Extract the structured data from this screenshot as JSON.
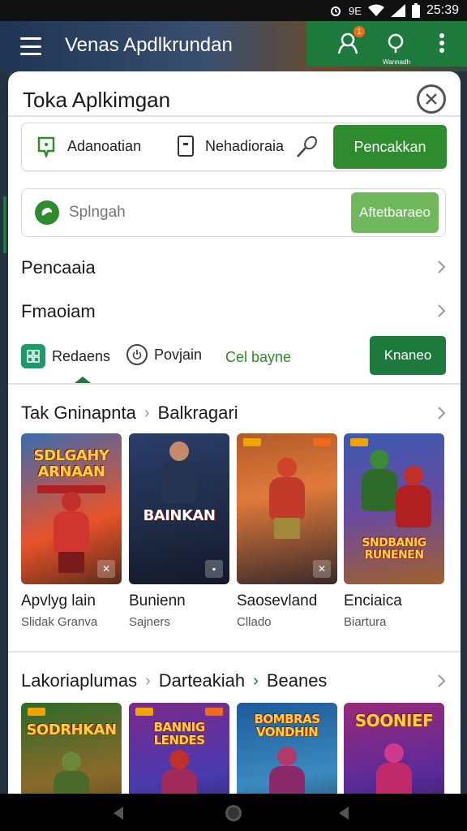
{
  "status_bar": {
    "time": "25:39",
    "network_label": "9E"
  },
  "app_bar": {
    "title": "Venas Apdlkrundan",
    "notification_count": "1",
    "action_caption": "Wannadh"
  },
  "sheet": {
    "title": "Toka Aplkimgan",
    "tabs": [
      {
        "label": "Adanoatian",
        "icon": "location-pin-icon"
      },
      {
        "label": "Nehadioraia",
        "icon": "device-icon"
      }
    ],
    "mic_icon": "microphone-icon",
    "primary_tab": "Pencakkan",
    "search": {
      "placeholder": "Splngah",
      "button": "Aftetbaraeo"
    },
    "menu": [
      {
        "label": "Pencaaia"
      },
      {
        "label": "Fmaoiam"
      }
    ],
    "filters": [
      {
        "label": "Redaens",
        "icon": "grid-icon"
      },
      {
        "label": "Povjain",
        "icon": "power-icon"
      }
    ],
    "filter_link": "Cel bayne",
    "filter_button": "Knaneo"
  },
  "sections": [
    {
      "breadcrumb": [
        "Tak Gninapnta",
        "Balkragari"
      ],
      "items": [
        {
          "cover_title": "SDLGAHY ARNAAN",
          "name": "Apvlyg lain",
          "sub": "Slidak Granva",
          "accent": "#e8542a"
        },
        {
          "cover_title": "BAINKAN",
          "name": "Bunienn",
          "sub": "Sajners",
          "accent": "#2a3e6a"
        },
        {
          "cover_title": "",
          "name": "Saosevland",
          "sub": "Cllado",
          "accent": "#d0432a"
        },
        {
          "cover_title": "SNDBANIG RUNENEN",
          "name": "Enciaica",
          "sub": "Biartura",
          "accent": "#3a5ab0"
        }
      ]
    },
    {
      "breadcrumb": [
        "Lakoriaplumas",
        "Darteakiah",
        "Beanes"
      ],
      "items": [
        {
          "cover_title": "SODRHKAN",
          "accent": "#2e6a2a"
        },
        {
          "cover_title": "BANNIG LENDES",
          "accent": "#7a2a8a"
        },
        {
          "cover_title": "BOMBRAS VONDHIN",
          "accent": "#1e5a9a"
        },
        {
          "cover_title": "SOONIEF",
          "accent": "#9a2a7a"
        }
      ]
    }
  ]
}
